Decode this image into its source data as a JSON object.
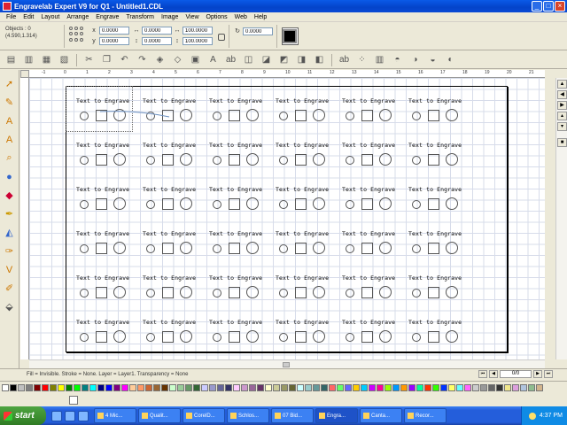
{
  "window": {
    "title": "Engravelab Expert V9 for Q1 - Untitled1.CDL"
  },
  "menu": [
    "File",
    "Edit",
    "Layout",
    "Arrange",
    "Engrave",
    "Transform",
    "Image",
    "View",
    "Options",
    "Web",
    "Help"
  ],
  "property_bar": {
    "objects_label": "Objects : 0",
    "coords": "(4.590,1.314)",
    "x": "0.0000",
    "y": "0.0000",
    "w": "0.0000",
    "h": "0.0000",
    "scale_x": "100.0000",
    "scale_y": "100.0000",
    "rotation": "0.0000"
  },
  "ruler_ticks": [
    "-1",
    "0",
    "1",
    "2",
    "3",
    "4",
    "5",
    "6",
    "7",
    "8",
    "9",
    "10",
    "11",
    "12",
    "13",
    "14",
    "15",
    "16",
    "17",
    "18",
    "19",
    "20",
    "21"
  ],
  "grid": {
    "cell_text": "Text to Engrave",
    "rows": 6,
    "cols": 6
  },
  "status": {
    "text": "Fill = Invisible. Stroke = None. Layer = Layer1. Transparency = None"
  },
  "page_nav": {
    "value": "0/0"
  },
  "palette_colors": [
    "#ffffff",
    "#000000",
    "#c0c0c0",
    "#808080",
    "#800000",
    "#ff0000",
    "#808000",
    "#ffff00",
    "#008000",
    "#00ff00",
    "#008080",
    "#00ffff",
    "#000080",
    "#0000ff",
    "#800080",
    "#ff00ff",
    "#ffcc99",
    "#ff9966",
    "#cc6633",
    "#996633",
    "#663300",
    "#ccffcc",
    "#99cc99",
    "#669966",
    "#336633",
    "#ccccff",
    "#9999cc",
    "#666699",
    "#333366",
    "#ffccff",
    "#cc99cc",
    "#996699",
    "#663366",
    "#ffffcc",
    "#cccc99",
    "#999966",
    "#666633",
    "#ccffff",
    "#99cccc",
    "#669999",
    "#336666",
    "#ff6666",
    "#66ff66",
    "#6666ff",
    "#ffcc00",
    "#00ccff",
    "#cc00ff",
    "#ff0099",
    "#99ff00",
    "#0099ff",
    "#ff9900",
    "#9900ff",
    "#00ff99",
    "#ff3300",
    "#33ff00",
    "#0033ff",
    "#ffff66",
    "#66ffff",
    "#ff66ff",
    "#cccccc",
    "#999999",
    "#666666",
    "#333333",
    "#f0e68c",
    "#dda0dd",
    "#b0c4de",
    "#8fbc8f",
    "#d2b48c"
  ],
  "taskbar": {
    "start_label": "start",
    "tasks": [
      "4 Mic...",
      "Qualit...",
      "CorelD...",
      "Schlos...",
      "07 Bid...",
      "Engra...",
      "Canta...",
      "Recor..."
    ],
    "active_index": 5,
    "clock": "4:37 PM"
  }
}
